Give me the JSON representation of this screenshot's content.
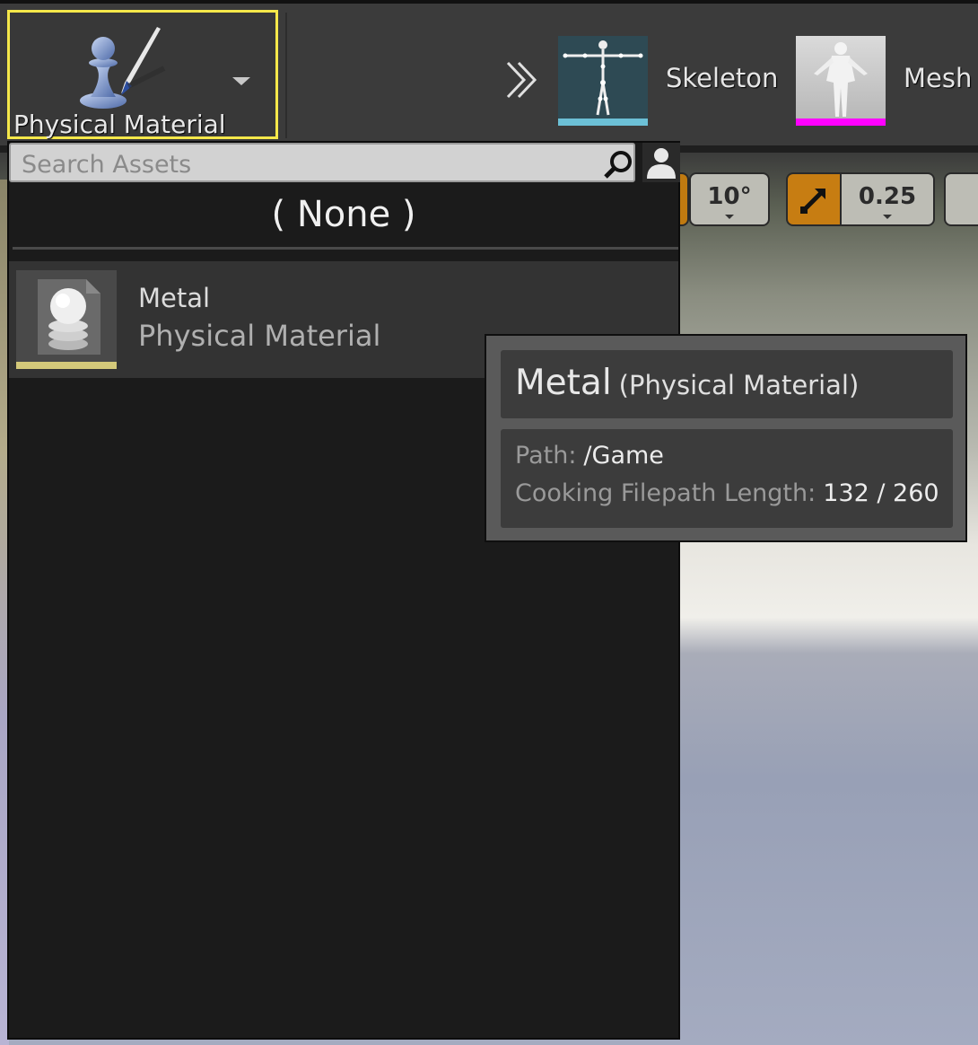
{
  "toolbar": {
    "active_tool": {
      "label": "Physical Material",
      "icon": "physical-material-paint-icon"
    },
    "more_icon": "double-chevron-right-icon",
    "assets": [
      {
        "label": "Skeleton",
        "thumb_icon": "skeleton-thumbnail",
        "accent": "#6cc0d6"
      },
      {
        "label": "Mesh",
        "thumb_icon": "mesh-thumbnail",
        "accent": "#ff00ff"
      }
    ]
  },
  "viewport_controls": {
    "rotation_snap": "10°",
    "scale_snap": "0.25",
    "scale_icon": "scale-arrow-icon"
  },
  "picker": {
    "search": {
      "placeholder": "Search Assets",
      "value": ""
    },
    "none_label": "( None )",
    "items": [
      {
        "name": "Metal",
        "type": "Physical Material",
        "accent": "#d4c97a"
      }
    ]
  },
  "tooltip": {
    "name": "Metal",
    "type": "(Physical Material)",
    "path_label": "Path:",
    "path_value": "/Game",
    "cook_label": "Cooking Filepath Length:",
    "cook_value": "132 / 260"
  }
}
